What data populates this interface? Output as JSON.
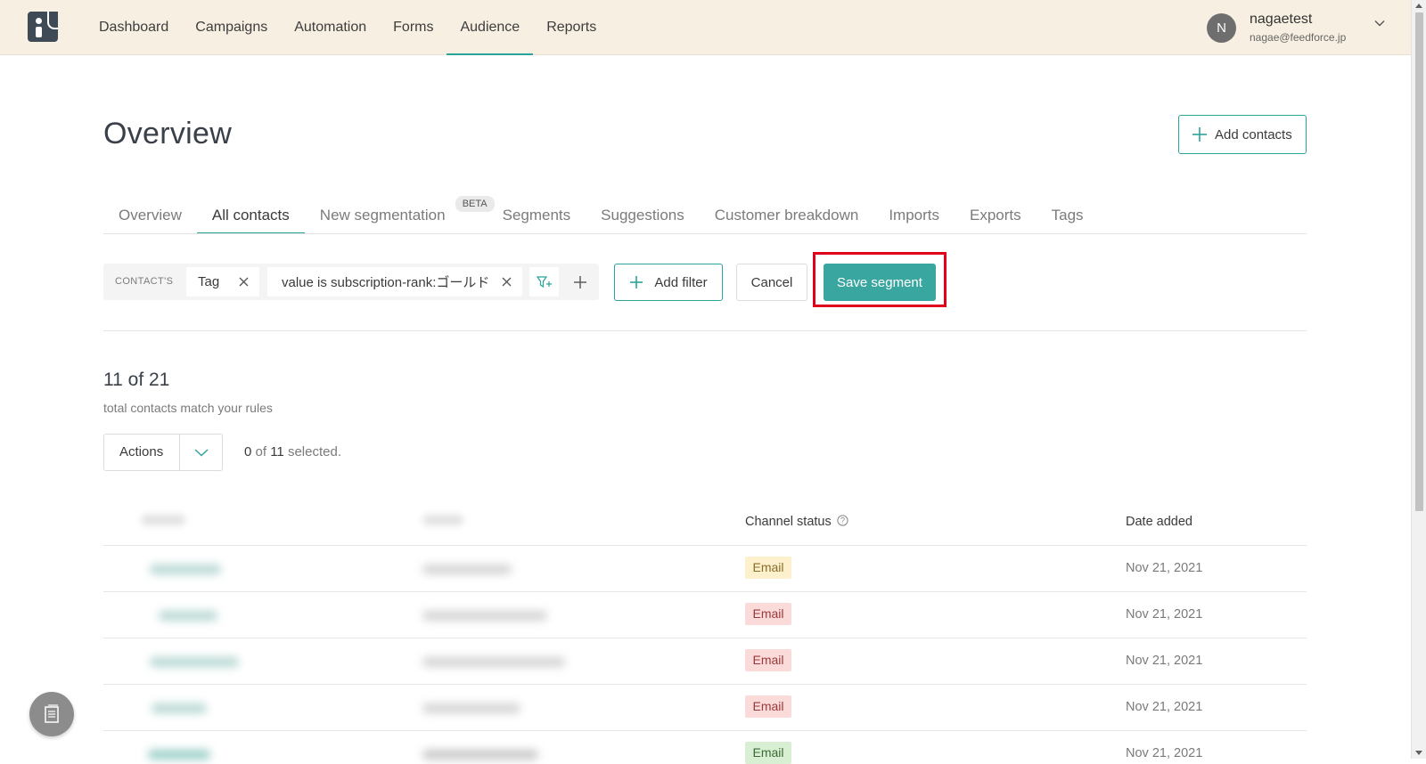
{
  "nav": {
    "items": [
      {
        "label": "Dashboard",
        "active": false
      },
      {
        "label": "Campaigns",
        "active": false
      },
      {
        "label": "Automation",
        "active": false
      },
      {
        "label": "Forms",
        "active": false
      },
      {
        "label": "Audience",
        "active": true
      },
      {
        "label": "Reports",
        "active": false
      }
    ]
  },
  "user": {
    "initial": "N",
    "name": "nagaetest",
    "email": "nagae@feedforce.jp"
  },
  "page": {
    "title": "Overview",
    "add_contacts_label": "Add contacts"
  },
  "tabs": [
    {
      "label": "Overview",
      "active": false
    },
    {
      "label": "All contacts",
      "active": true
    },
    {
      "label": "New segmentation",
      "active": false,
      "badge": "BETA"
    },
    {
      "label": "Segments",
      "active": false
    },
    {
      "label": "Suggestions",
      "active": false
    },
    {
      "label": "Customer breakdown",
      "active": false
    },
    {
      "label": "Imports",
      "active": false
    },
    {
      "label": "Exports",
      "active": false
    },
    {
      "label": "Tags",
      "active": false
    }
  ],
  "filter": {
    "prefix": "CONTACT'S",
    "field": "Tag",
    "condition": "value is subscription-rank:ゴールド",
    "add_filter_label": "Add filter",
    "cancel_label": "Cancel",
    "save_label": "Save segment"
  },
  "results": {
    "count": "11 of 21",
    "subtitle": "total contacts match your rules",
    "actions_label": "Actions",
    "selected_count": "0",
    "selected_total": "11",
    "selected_suffix": "selected."
  },
  "table": {
    "headers": {
      "channel_status": "Channel status",
      "date_added": "Date added"
    },
    "rows": [
      {
        "channel": "Email",
        "status": "yellow",
        "date": "Nov 21, 2021"
      },
      {
        "channel": "Email",
        "status": "red",
        "date": "Nov 21, 2021"
      },
      {
        "channel": "Email",
        "status": "red",
        "date": "Nov 21, 2021"
      },
      {
        "channel": "Email",
        "status": "red",
        "date": "Nov 21, 2021"
      },
      {
        "channel": "Email",
        "status": "green",
        "date": "Nov 21, 2021"
      }
    ]
  },
  "colors": {
    "accent": "#2aa39a",
    "primary_button": "#3aa6a0",
    "highlight": "#e0001b",
    "topbar": "#f7efe2"
  }
}
